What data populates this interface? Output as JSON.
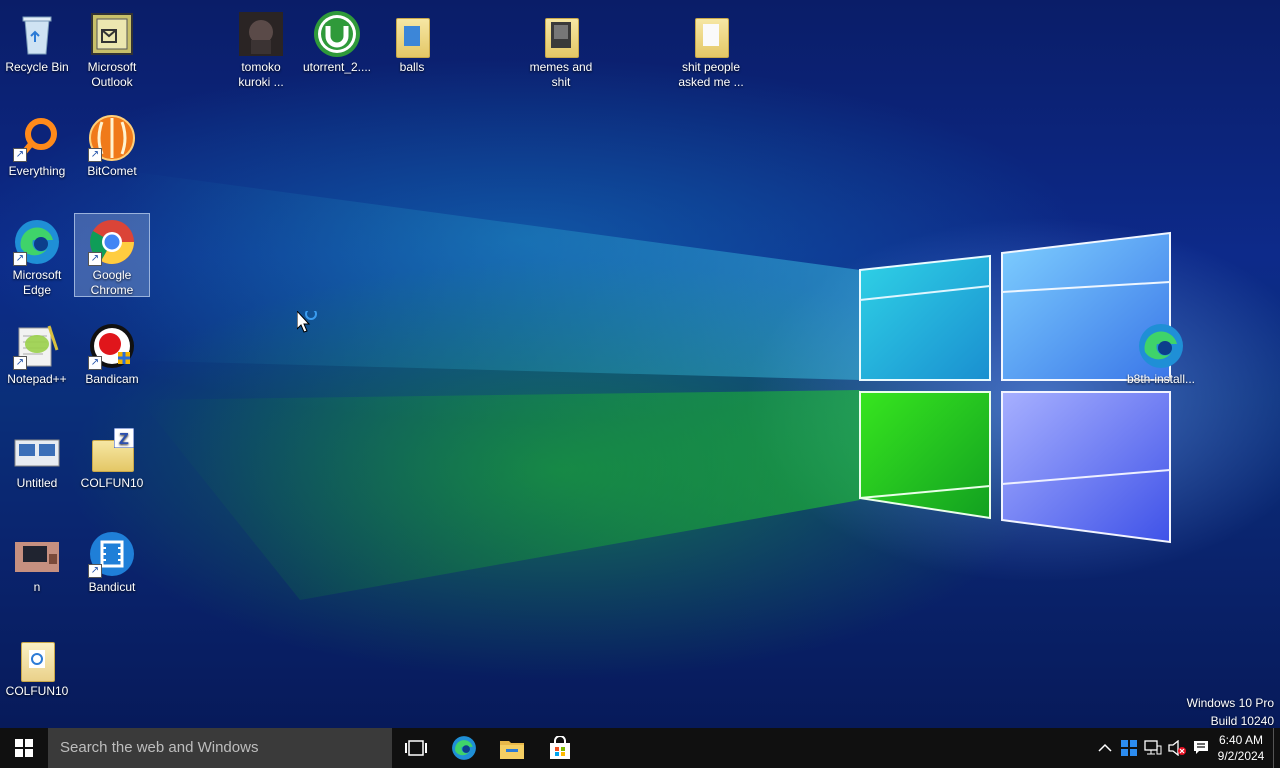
{
  "desktop": {
    "icons": [
      {
        "label": "Recycle Bin"
      },
      {
        "label": "Microsoft Outlook"
      },
      {
        "label": "tomoko kuroki ..."
      },
      {
        "label": "utorrent_2...."
      },
      {
        "label": "balls"
      },
      {
        "label": "memes and shit"
      },
      {
        "label": "shit people asked me ..."
      },
      {
        "label": "Everything"
      },
      {
        "label": "BitComet"
      },
      {
        "label": "Microsoft Edge"
      },
      {
        "label": "Google Chrome"
      },
      {
        "label": "Notepad++"
      },
      {
        "label": "Bandicam"
      },
      {
        "label": "Untitled"
      },
      {
        "label": "COLFUN10"
      },
      {
        "label": "n"
      },
      {
        "label": "Bandicut"
      },
      {
        "label": "COLFUN10"
      },
      {
        "label": "b8th-install..."
      }
    ]
  },
  "watermark": {
    "line1": "Windows 10 Pro",
    "line2": "Build 10240"
  },
  "taskbar": {
    "search_placeholder": "Search the web and Windows",
    "clock_time": "6:40 AM",
    "clock_date": "9/2/2024"
  }
}
